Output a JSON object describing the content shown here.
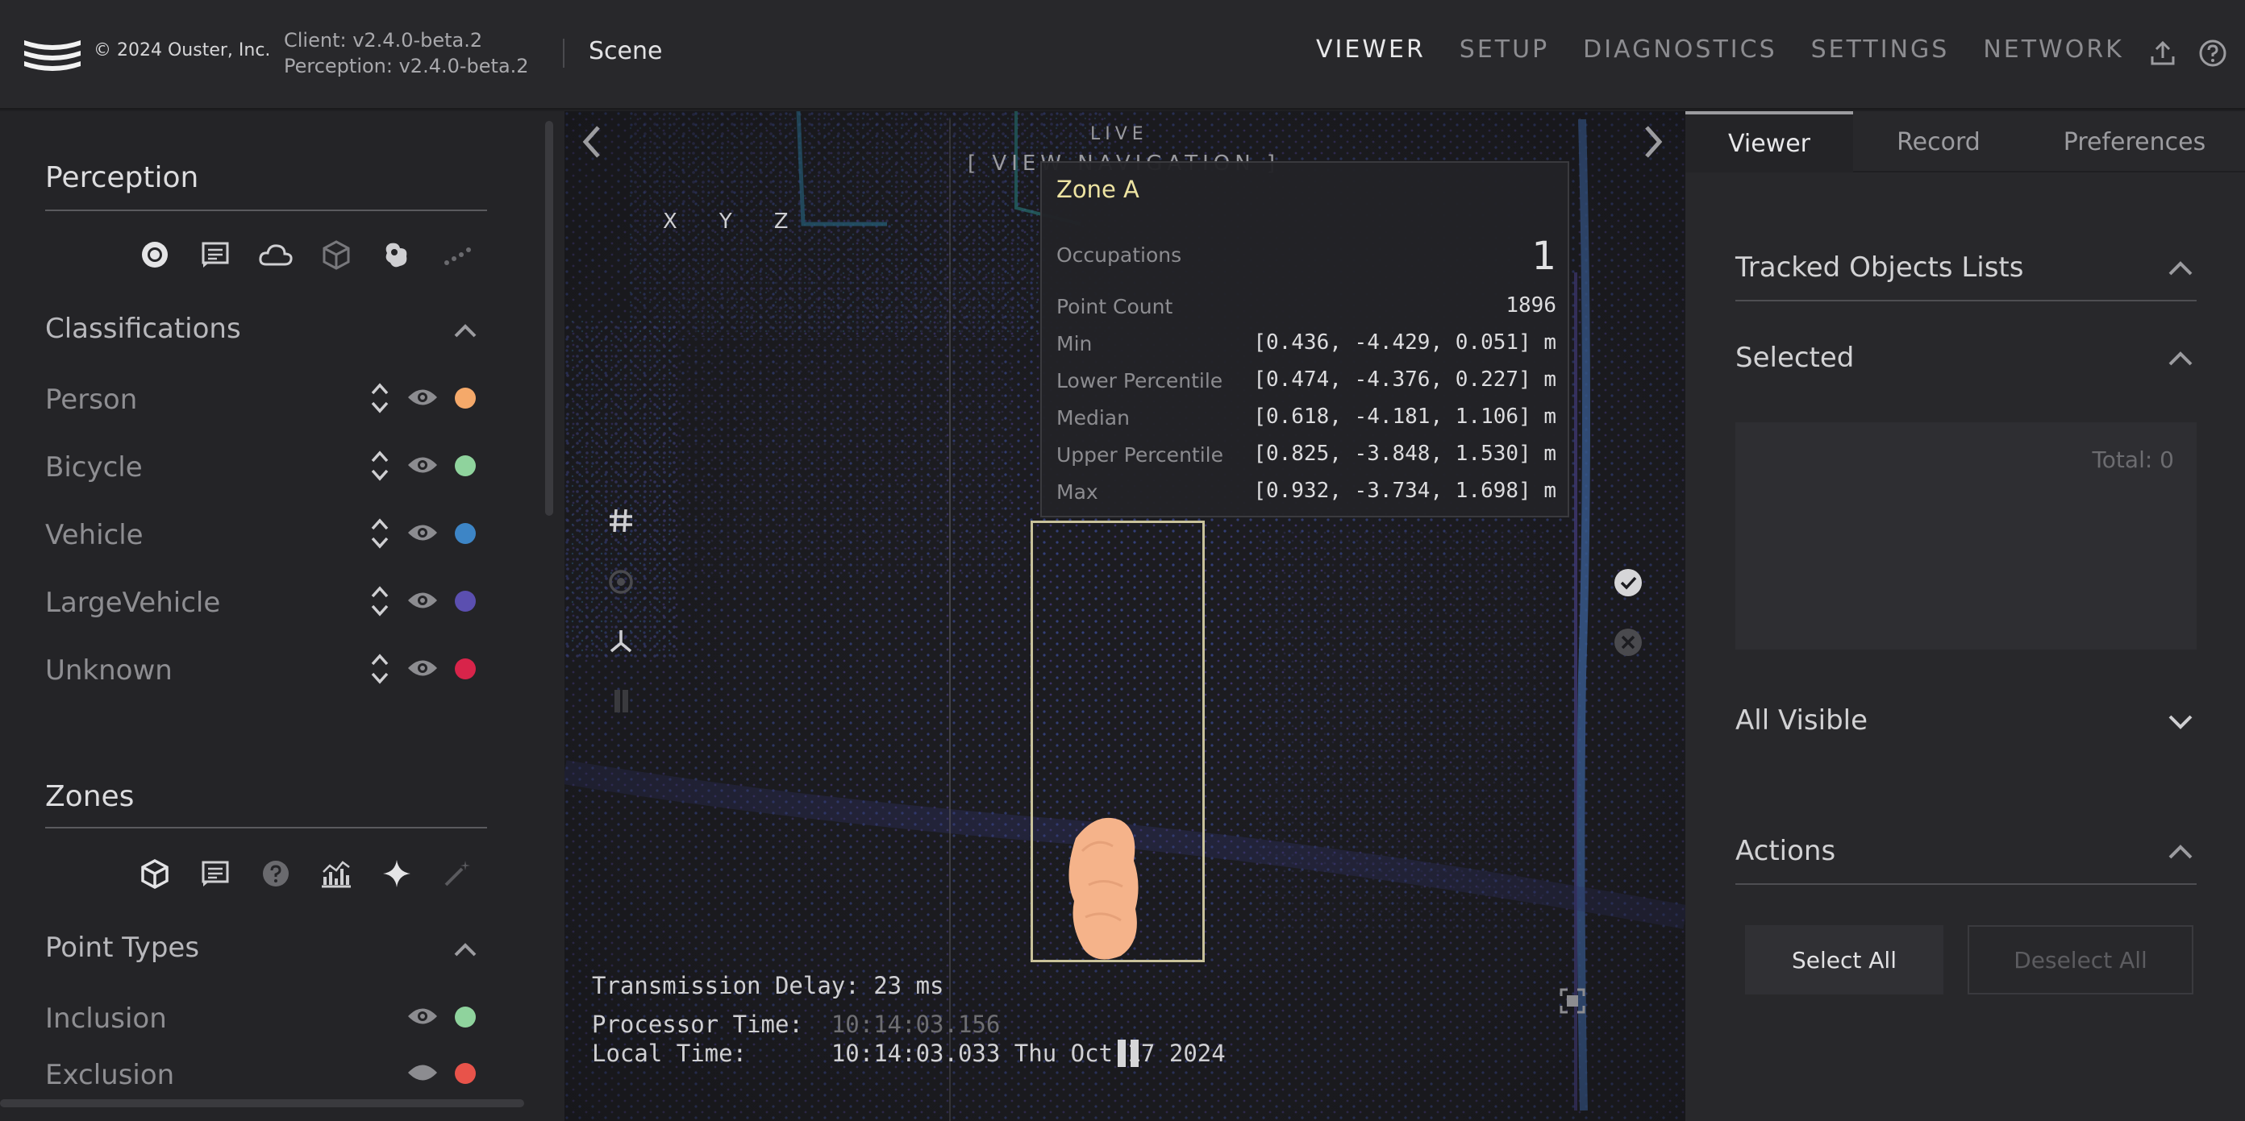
{
  "header": {
    "copyright": "© 2024 Ouster, Inc.",
    "client_version": "Client: v2.4.0-beta.2",
    "perception_version": "Perception: v2.4.0-beta.2",
    "scene": "Scene",
    "nav": [
      "VIEWER",
      "SETUP",
      "DIAGNOSTICS",
      "SETTINGS",
      "NETWORK"
    ],
    "icons": [
      "upload-icon",
      "help-icon"
    ]
  },
  "left_panel": {
    "perception": {
      "title": "Perception",
      "icons": [
        "sphere-icon",
        "notes-icon",
        "cloud-icon",
        "cube-icon",
        "blob-icon",
        "trail-icon"
      ]
    },
    "classifications": {
      "title": "Classifications",
      "items": [
        {
          "label": "Person",
          "color": "#f5a96a"
        },
        {
          "label": "Bicycle",
          "color": "#8fd39d"
        },
        {
          "label": "Vehicle",
          "color": "#3d85c6"
        },
        {
          "label": "LargeVehicle",
          "color": "#5b4fb0"
        },
        {
          "label": "Unknown",
          "color": "#d8244a"
        }
      ]
    },
    "zones": {
      "title": "Zones",
      "icons": [
        "box-icon",
        "notes-icon",
        "help-icon",
        "chart-icon",
        "sparkle-icon",
        "wand-icon"
      ]
    },
    "point_types": {
      "title": "Point Types",
      "items": [
        {
          "label": "Inclusion",
          "color": "#8fd39d"
        },
        {
          "label": "Exclusion",
          "color": "#e8534a"
        }
      ]
    }
  },
  "viewer": {
    "live": "LIVE",
    "view_navigation": "[ VIEW NAVIGATION ]",
    "axes": [
      "X",
      "Y",
      "Z"
    ],
    "tooltip": {
      "title": "Zone A",
      "occupations_label": "Occupations",
      "occupations_value": "1",
      "rows": [
        {
          "label": "Point Count",
          "value": "1896"
        },
        {
          "label": "Min",
          "value": "[0.436, -4.429, 0.051] m"
        },
        {
          "label": "Lower Percentile",
          "value": "[0.474, -4.376, 0.227] m"
        },
        {
          "label": "Median",
          "value": "[0.618, -4.181, 1.106] m"
        },
        {
          "label": "Upper Percentile",
          "value": "[0.825, -3.848, 1.530] m"
        },
        {
          "label": "Max",
          "value": "[0.932, -3.734, 1.698] m"
        }
      ]
    },
    "transmission_delay": "Transmission Delay: 23 ms",
    "processor_label": "Processor Time:",
    "processor_value": "10:14:03.156",
    "local_label": "Local Time:",
    "local_value": "10:14:03.033 Thu Oct 17 2024"
  },
  "right_panel": {
    "tabs": [
      "Viewer",
      "Record",
      "Preferences"
    ],
    "tracked_objects": "Tracked Objects Lists",
    "selected": "Selected",
    "total": "Total: 0",
    "all_visible": "All Visible",
    "actions": "Actions",
    "select_all": "Select All",
    "deselect_all": "Deselect All"
  }
}
